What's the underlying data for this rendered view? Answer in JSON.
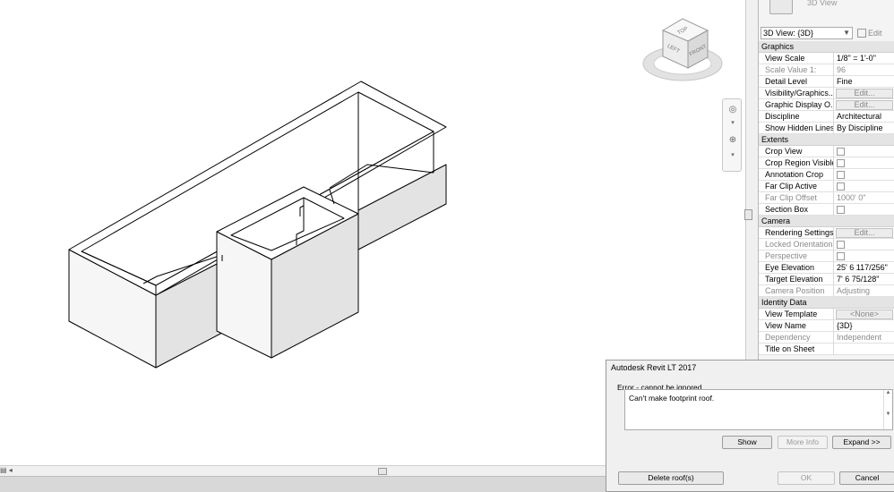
{
  "viewcube": {
    "top_face": "TOP",
    "left_face": "LEFT",
    "front_face": "FRONT"
  },
  "properties": {
    "type_name": "3D View",
    "view_selector": "3D View: {3D}",
    "edit_type_label": "Edit Type",
    "sections": [
      {
        "title": "Graphics",
        "rows": [
          {
            "label": "View Scale",
            "value": "1/8\" = 1'-0\"",
            "kind": "text"
          },
          {
            "label": "Scale Value    1:",
            "value": "96",
            "kind": "text",
            "disabled": true
          },
          {
            "label": "Detail Level",
            "value": "Fine",
            "kind": "text"
          },
          {
            "label": "Visibility/Graphics...",
            "value": "Edit...",
            "kind": "button"
          },
          {
            "label": "Graphic Display O...",
            "value": "Edit...",
            "kind": "button"
          },
          {
            "label": "Discipline",
            "value": "Architectural",
            "kind": "text"
          },
          {
            "label": "Show Hidden Lines",
            "value": "By Discipline",
            "kind": "text"
          }
        ]
      },
      {
        "title": "Extents",
        "rows": [
          {
            "label": "Crop View",
            "value": "",
            "kind": "check"
          },
          {
            "label": "Crop Region Visible",
            "value": "",
            "kind": "check"
          },
          {
            "label": "Annotation Crop",
            "value": "",
            "kind": "check"
          },
          {
            "label": "Far Clip Active",
            "value": "",
            "kind": "check"
          },
          {
            "label": "Far Clip Offset",
            "value": "1000'  0\"",
            "kind": "text",
            "disabled": true
          },
          {
            "label": "Section Box",
            "value": "",
            "kind": "check"
          }
        ]
      },
      {
        "title": "Camera",
        "rows": [
          {
            "label": "Rendering Settings",
            "value": "Edit...",
            "kind": "button"
          },
          {
            "label": "Locked Orientation",
            "value": "",
            "kind": "check",
            "disabled": true
          },
          {
            "label": "Perspective",
            "value": "",
            "kind": "check",
            "disabled": true
          },
          {
            "label": "Eye Elevation",
            "value": "25'  6 117/256\"",
            "kind": "text"
          },
          {
            "label": "Target Elevation",
            "value": "7'  6 75/128\"",
            "kind": "text"
          },
          {
            "label": "Camera Position",
            "value": "Adjusting",
            "kind": "text",
            "disabled": true
          }
        ]
      },
      {
        "title": "Identity Data",
        "rows": [
          {
            "label": "View Template",
            "value": "<None>",
            "kind": "button"
          },
          {
            "label": "View Name",
            "value": "{3D}",
            "kind": "text"
          },
          {
            "label": "Dependency",
            "value": "Independent",
            "kind": "text",
            "disabled": true
          },
          {
            "label": "Title on Sheet",
            "value": "",
            "kind": "text"
          }
        ]
      }
    ]
  },
  "dialog": {
    "title": "Autodesk Revit LT 2017",
    "group_label": "Error - cannot be ignored",
    "message": "Can't make footprint roof.",
    "buttons": {
      "show": "Show",
      "more_info": "More Info",
      "expand": "Expand >>",
      "delete": "Delete roof(s)",
      "ok": "OK",
      "cancel": "Cancel"
    }
  }
}
